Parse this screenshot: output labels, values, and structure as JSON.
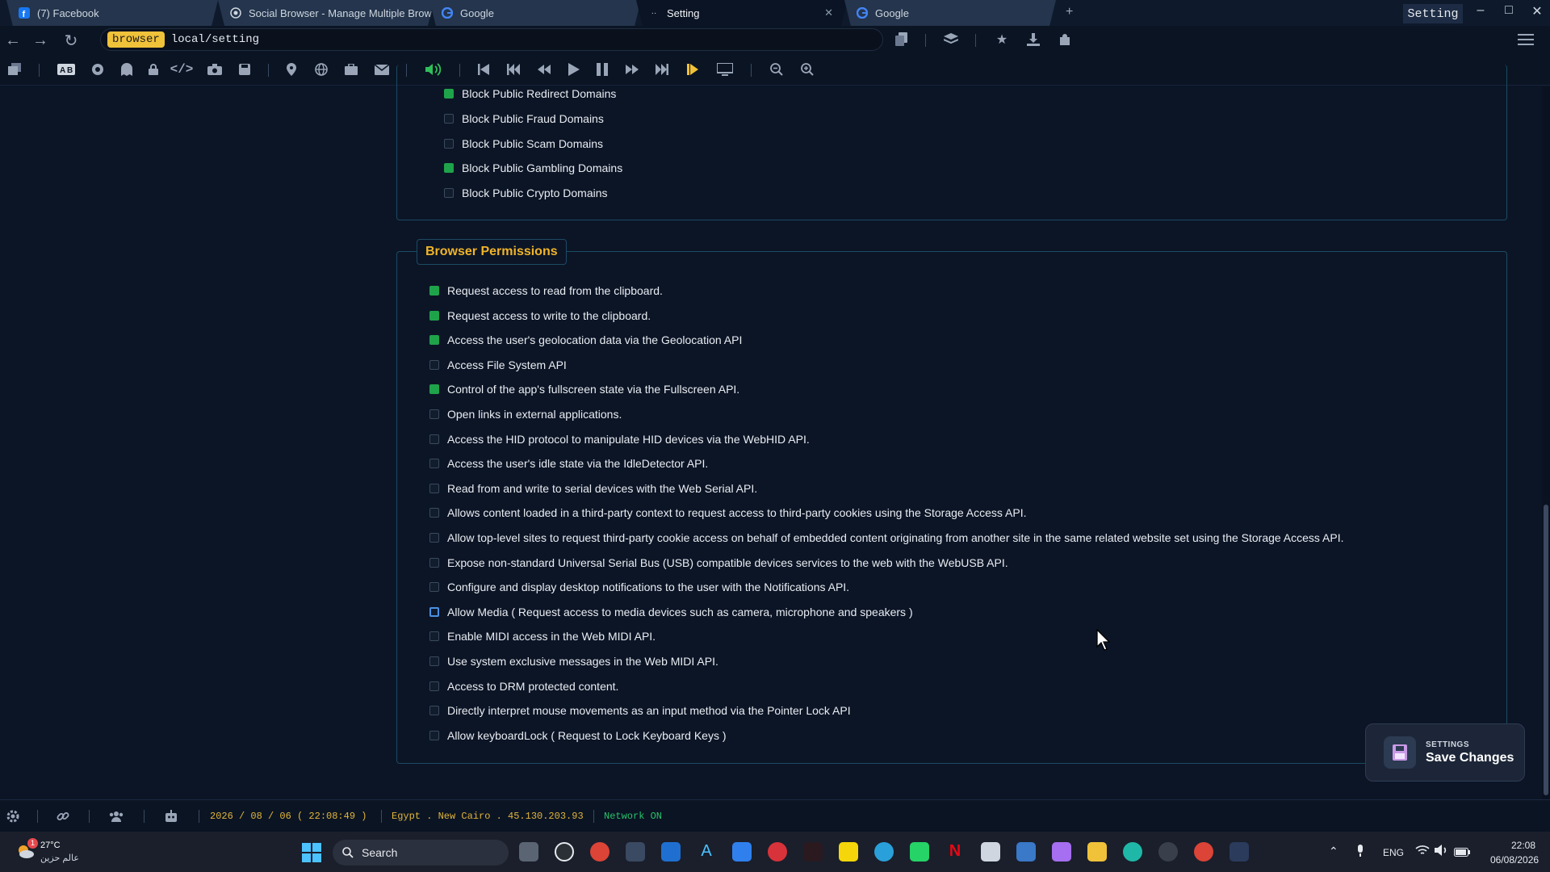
{
  "tabs": [
    {
      "label": "(7) Facebook",
      "icon": "facebook-icon"
    },
    {
      "label": "Social Browser - Manage Multiple Brow",
      "icon": "social-browser-icon"
    },
    {
      "label": "Google",
      "icon": "google-icon"
    },
    {
      "label": "Setting",
      "icon": "dots-icon"
    },
    {
      "label": "Google",
      "icon": "google-icon"
    }
  ],
  "window": {
    "title": "Setting",
    "new_tab": "+",
    "minimize": "–",
    "maximize": "□",
    "close": "✕",
    "tab_close": "✕"
  },
  "address": {
    "badge": "browser",
    "url": "local/setting"
  },
  "domains": {
    "items": [
      {
        "label": "Block Public Redirect Domains",
        "checked": true
      },
      {
        "label": "Block Public Fraud Domains",
        "checked": false
      },
      {
        "label": "Block Public Scam Domains",
        "checked": false
      },
      {
        "label": "Block Public Gambling Domains",
        "checked": true
      },
      {
        "label": "Block Public Crypto Domains",
        "checked": false
      }
    ]
  },
  "permissions": {
    "title": "Browser Permissions",
    "items": [
      {
        "label": "Request access to read from the clipboard.",
        "checked": true
      },
      {
        "label": "Request access to write to the clipboard.",
        "checked": true
      },
      {
        "label": "Access the user's geolocation data via the Geolocation API",
        "checked": true
      },
      {
        "label": "Access File System API",
        "checked": false
      },
      {
        "label": "Control of the app's fullscreen state via the Fullscreen API.",
        "checked": true
      },
      {
        "label": "Open links in external applications.",
        "checked": false
      },
      {
        "label": "Access the HID protocol to manipulate HID devices via the WebHID API.",
        "checked": false
      },
      {
        "label": "Access the user's idle state via the IdleDetector API.",
        "checked": false
      },
      {
        "label": "Read from and write to serial devices with the Web Serial API.",
        "checked": false
      },
      {
        "label": "Allows content loaded in a third-party context to request access to third-party cookies using the Storage Access API.",
        "checked": false
      },
      {
        "label": "Allow top-level sites to request third-party cookie access on behalf of embedded content originating from another site in the same related website set using the Storage Access API.",
        "checked": false
      },
      {
        "label": "Expose non-standard Universal Serial Bus (USB) compatible devices services to the web with the WebUSB API.",
        "checked": false
      },
      {
        "label": "Configure and display desktop notifications to the user with the Notifications API.",
        "checked": false
      },
      {
        "label": "Allow Media ( Request access to media devices such as camera, microphone and speakers )",
        "checked": false,
        "focused": true
      },
      {
        "label": "Enable MIDI access in the Web MIDI API.",
        "checked": false
      },
      {
        "label": "Use system exclusive messages in the Web MIDI API.",
        "checked": false
      },
      {
        "label": "Access to DRM protected content.",
        "checked": false
      },
      {
        "label": "Directly interpret mouse movements as an input method via the Pointer Lock API",
        "checked": false
      },
      {
        "label": "Allow keyboardLock ( Request to Lock Keyboard Keys )",
        "checked": false
      }
    ]
  },
  "save": {
    "small": "SETTINGS",
    "big": "Save Changes"
  },
  "status": {
    "datetime": "2026 / 08 / 06 ( 22:08:49 )",
    "location": "Egypt . New Cairo . 45.130.203.93",
    "network": "Network ON"
  },
  "taskbar": {
    "weather_temp": "27°C",
    "weather_text": "عالم حزين",
    "weather_badge": "1",
    "search": "Search",
    "lang": "ENG",
    "time": "22:08",
    "date": "06/08/2026"
  },
  "colors": {
    "checked": "#1fa34a",
    "legend": "#f0b429",
    "badge": "#f0c23a",
    "network_on": "#27c46b",
    "status_text": "#e0b53a"
  }
}
